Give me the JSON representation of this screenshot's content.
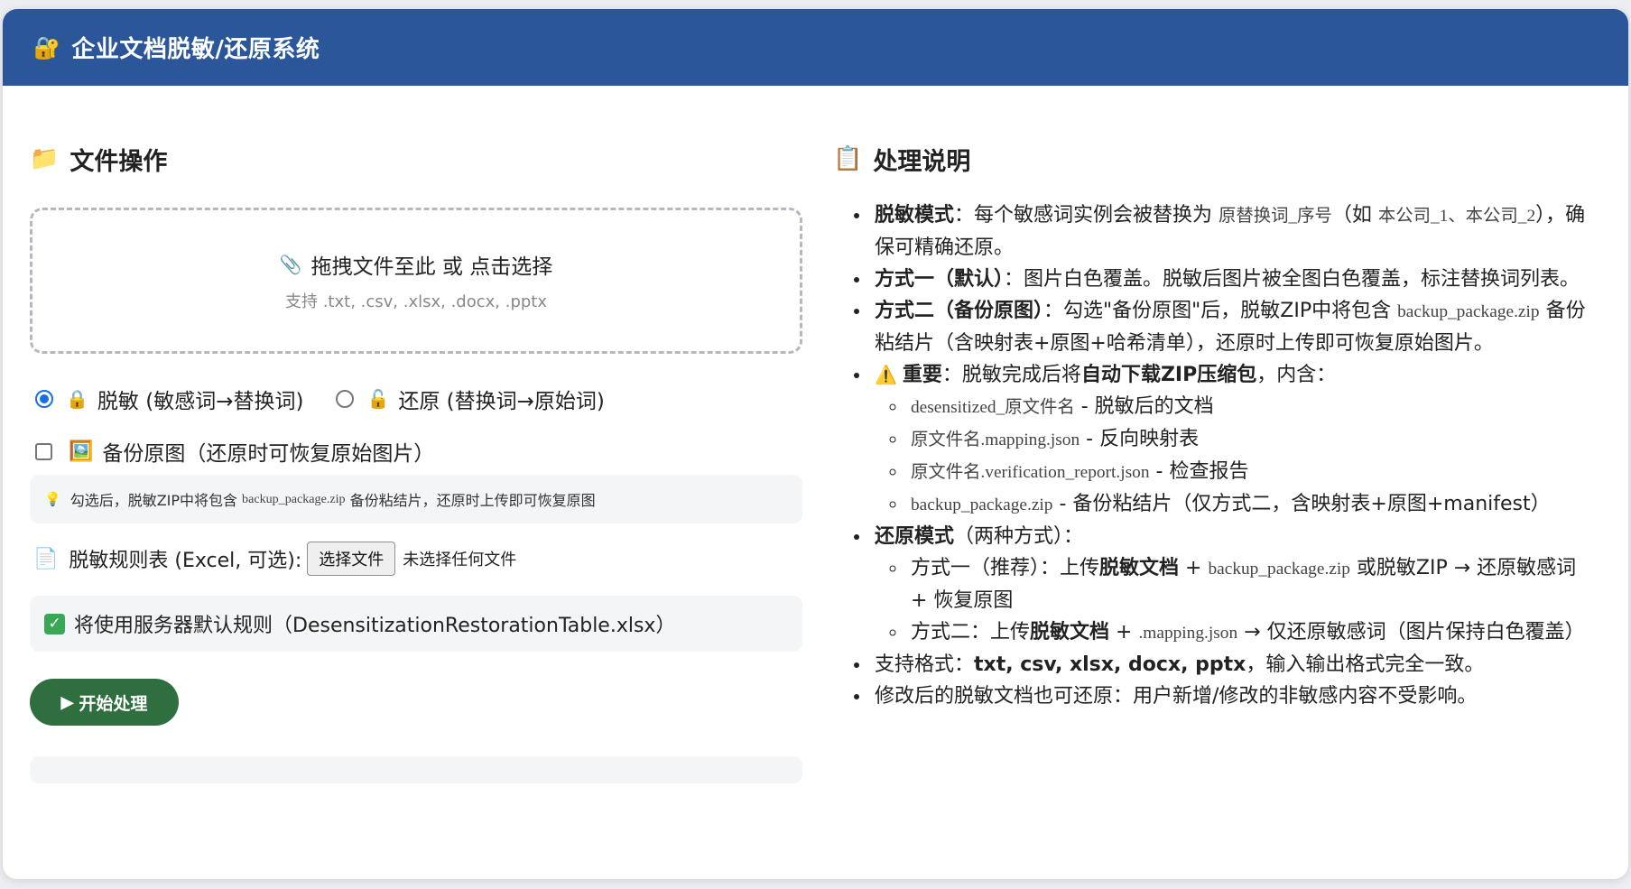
{
  "header": {
    "title": "企业文档脱敏/还原系统",
    "icon": "lock-icon"
  },
  "left": {
    "section_title": "文件操作",
    "section_icon": "folder-icon",
    "dropzone": {
      "main": "拖拽文件至此 或 点击选择",
      "sub": "支持 .txt, .csv, .xlsx, .docx, .pptx",
      "icon": "paperclip-icon"
    },
    "mode": {
      "desensitize_label": "脱敏 (敏感词→替换词)",
      "restore_label": "还原 (替换词→原始词)",
      "selected": "desensitize"
    },
    "backup": {
      "label": "备份原图（还原时可恢复原始图片）",
      "checked": false
    },
    "hint": {
      "prefix": "勾选后，脱敏ZIP中将包含",
      "code": "backup_package.zip",
      "suffix": "备份粘结片，还原时上传即可恢复原图"
    },
    "rules_file": {
      "label": "脱敏规则表 (Excel, 可选):",
      "button": "选择文件",
      "status": "未选择任何文件"
    },
    "rules_default": "将使用服务器默认规则（DesensitizationRestorationTable.xlsx）",
    "start_button": "开始处理"
  },
  "right": {
    "section_title": "处理说明",
    "section_icon": "clipboard-icon",
    "items": {
      "i1_b": "脱敏模式",
      "i1_t1": "：每个敏感词实例会被替换为",
      "i1_c1": "原替换词_序号",
      "i1_t2": "（如",
      "i1_c2": "本公司_1、本公司_2",
      "i1_t3": "），确保可精确还原。",
      "i2_b": "方式一（默认）",
      "i2_t": "：图片白色覆盖。脱敏后图片被全图白色覆盖，标注替换词列表。",
      "i3_b": "方式二（备份原图）",
      "i3_t1": "：勾选\"备份原图\"后，脱敏ZIP中将包含",
      "i3_c": "backup_package.zip",
      "i3_t2": "备份粘结片（含映射表+原图+哈希清单），还原时上传即可恢复原始图片。",
      "i4_b1": "重要",
      "i4_t1": "：脱敏完成后将",
      "i4_b2": "自动下载ZIP压缩包",
      "i4_t2": "，内含：",
      "s1_c": "desensitized_原文件名",
      "s1_t": " - 脱敏后的文档",
      "s2_c": "原文件名.mapping.json",
      "s2_t": " - 反向映射表",
      "s3_c": "原文件名.verification_report.json",
      "s3_t": " - 检查报告",
      "s4_c": "backup_package.zip",
      "s4_t": " - 备份粘结片（仅方式二，含映射表+原图+manifest）",
      "i5_b": "还原模式",
      "i5_t": "（两种方式）：",
      "r1_t1": "方式一（推荐）：上传",
      "r1_b": "脱敏文档",
      "r1_t2": " + ",
      "r1_c": "backup_package.zip",
      "r1_t3": " 或脱敏ZIP → 还原敏感词 + 恢复原图",
      "r2_t1": "方式二：上传",
      "r2_b": "脱敏文档",
      "r2_t2": " + ",
      "r2_c": ".mapping.json",
      "r2_t3": " → 仅还原敏感词（图片保持白色覆盖）",
      "i6_t1": "支持格式：",
      "i6_b": "txt, csv, xlsx, docx, pptx",
      "i6_t2": "，输入输出格式完全一致。",
      "i7_t": "修改后的脱敏文档也可还原：用户新增/修改的非敏感内容不受影响。"
    }
  }
}
